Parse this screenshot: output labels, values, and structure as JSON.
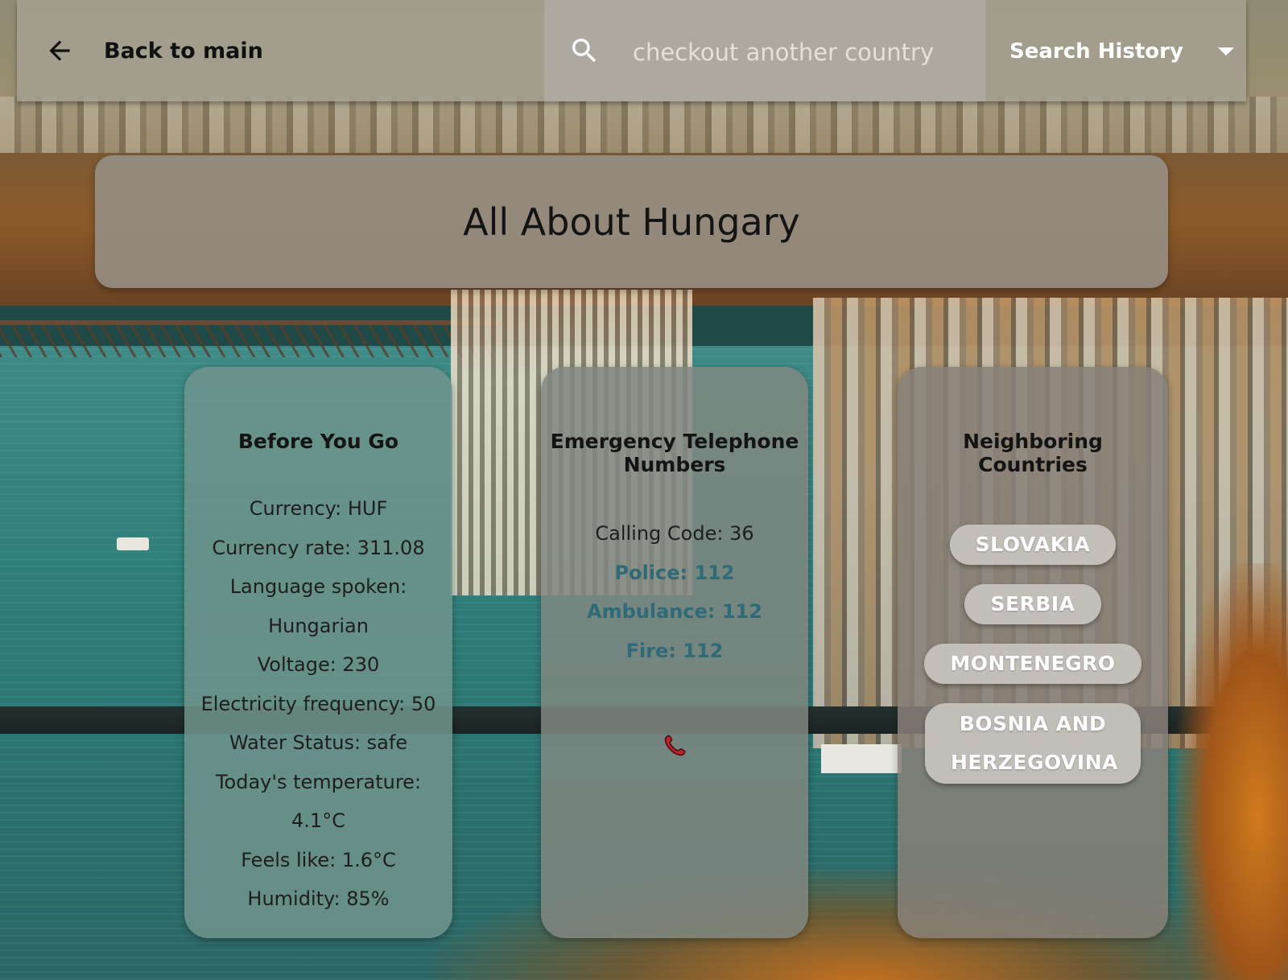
{
  "header": {
    "back_label": "Back to main",
    "search_placeholder": "checkout another country",
    "history_label": "Search History"
  },
  "title": "All About Hungary",
  "before_you_go": {
    "heading": "Before You Go",
    "lines": [
      "Currency: HUF",
      "Currency rate: 311.08",
      "Language spoken:",
      "Hungarian",
      "Voltage: 230",
      "Electricity frequency: 50",
      "Water Status: safe",
      "Today's temperature:",
      "4.1°C",
      "Feels like: 1.6°C",
      "Humidity: 85%"
    ]
  },
  "emergency": {
    "heading": "Emergency Telephone Numbers",
    "calling_code": "Calling Code: 36",
    "police": "Police: 112",
    "ambulance": "Ambulance: 112",
    "fire": "Fire: 112",
    "icon": "phone-icon"
  },
  "neighbors": {
    "heading": "Neighboring Countries",
    "countries": [
      "SLOVAKIA",
      "SERBIA",
      "MONTENEGRO",
      "BOSNIA AND HERZEGOVINA"
    ]
  },
  "colors": {
    "emergency_link": "#2f6a78",
    "phone_icon": "#c0242a",
    "chip_text": "#ffffff"
  }
}
